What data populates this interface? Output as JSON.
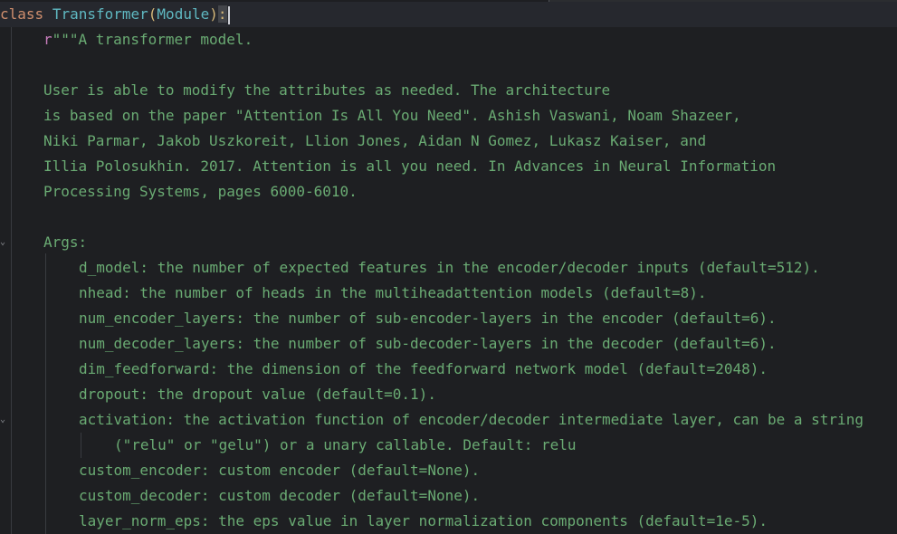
{
  "editor": {
    "class_line": {
      "keyword": "class",
      "class_name": "Transformer",
      "open_paren": "(",
      "base_class": "Module",
      "close_paren": ")",
      "colon": ":"
    },
    "doc_prefix": "r",
    "doc_lines": [
      "\"\"\"A transformer model.",
      "",
      "User is able to modify the attributes as needed. The architecture",
      "is based on the paper \"Attention Is All You Need\". Ashish Vaswani, Noam Shazeer,",
      "Niki Parmar, Jakob Uszkoreit, Llion Jones, Aidan N Gomez, Lukasz Kaiser, and",
      "Illia Polosukhin. 2017. Attention is all you need. In Advances in Neural Information",
      "Processing Systems, pages 6000-6010.",
      "",
      "Args:",
      "d_model: the number of expected features in the encoder/decoder inputs (default=512).",
      "nhead: the number of heads in the multiheadattention models (default=8).",
      "num_encoder_layers: the number of sub-encoder-layers in the encoder (default=6).",
      "num_decoder_layers: the number of sub-decoder-layers in the decoder (default=6).",
      "dim_feedforward: the dimension of the feedforward network model (default=2048).",
      "dropout: the dropout value (default=0.1).",
      "activation: the activation function of encoder/decoder intermediate layer, can be a string",
      "(\"relu\" or \"gelu\") or a unary callable. Default: relu",
      "custom_encoder: custom encoder (default=None).",
      "custom_decoder: custom decoder (default=None).",
      "layer_norm_eps: the eps value in layer normalization components (default=1e-5)."
    ]
  }
}
